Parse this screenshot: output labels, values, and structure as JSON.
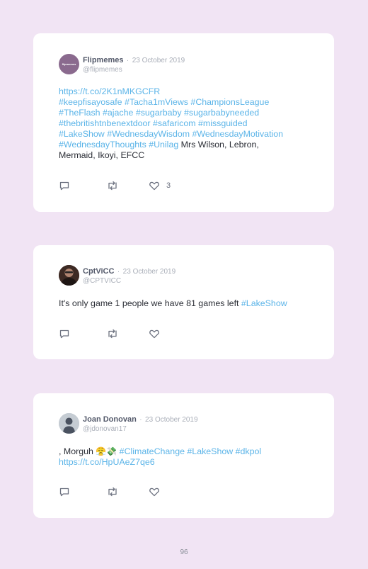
{
  "tweets": [
    {
      "name": "Flipmemes",
      "separator": "·",
      "date": "23 October 2019",
      "handle": "@flipmemes",
      "avatar_text": "flipmemes",
      "link_url": "https://t.co/2K1nMKGCFR",
      "hashtags_1": "#keepfisayosafe #Tacha1mViews #ChampionsLeague",
      "hashtags_2": "#TheFlash #ajache #sugarbaby #sugarbabyneeded",
      "hashtags_3": "#thebritishtnbenextdoor #safaricom #missguided",
      "hashtags_4": "#LakeShow #WednesdayWisdom #WednesdayMotivation",
      "hashtags_5": "#WednesdayThoughts #Unilag",
      "text_after": " Mrs Wilson, Lebron,",
      "text_line_7": "Mermaid, Ikoyi, EFCC",
      "like_count": "3"
    },
    {
      "name": "CptViCC",
      "separator": "·",
      "date": "23 October 2019",
      "handle": "@CPTVICC",
      "text": "It's only game 1 people we have 81 games left ",
      "hashtag": "#LakeShow"
    },
    {
      "name": "Joan Donovan",
      "separator": "·",
      "date": "23 October 2019",
      "handle": "@jdonovan17",
      "text": ", Morguh ",
      "emoji": "😤💸",
      "hashtags": " #ClimateChange #LakeShow #dkpol",
      "link_url": "https://t.co/HpUAeZ7qe6"
    }
  ],
  "icons": {
    "reply": "reply-icon",
    "retweet": "retweet-icon",
    "like": "like-icon"
  },
  "colors": {
    "background": "#f1e4f4",
    "card": "#ffffff",
    "link": "#5bb4e8",
    "icon": "#6d7280"
  },
  "page_number": "96"
}
